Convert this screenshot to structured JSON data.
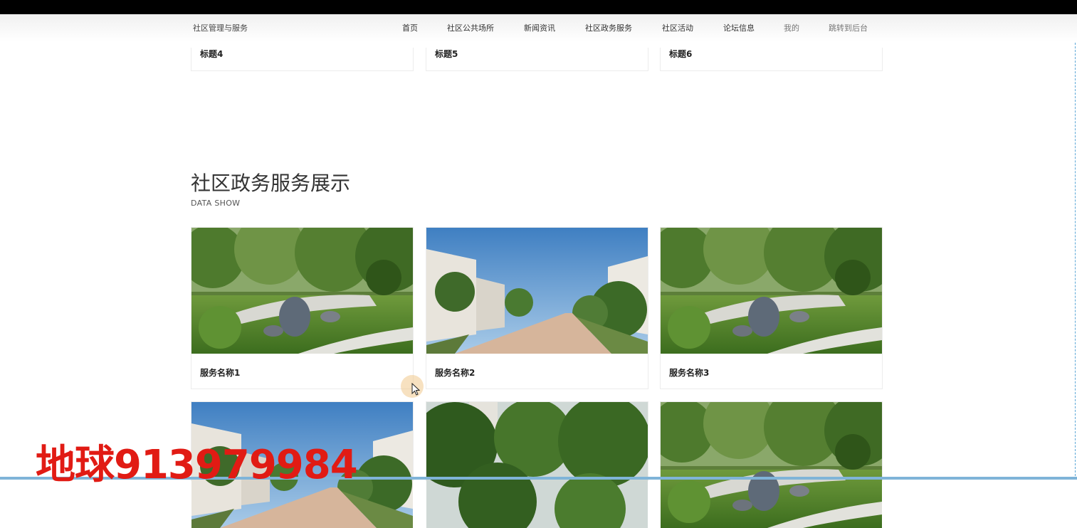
{
  "nav": {
    "brand": "社区管理与服务",
    "items": [
      {
        "label": "首页",
        "muted": false
      },
      {
        "label": "社区公共场所",
        "muted": false
      },
      {
        "label": "新闻资讯",
        "muted": false
      },
      {
        "label": "社区政务服务",
        "muted": false
      },
      {
        "label": "社区活动",
        "muted": false
      },
      {
        "label": "论坛信息",
        "muted": false
      },
      {
        "label": "我的",
        "muted": true
      },
      {
        "label": "跳转到后台",
        "muted": true
      }
    ]
  },
  "prev_section": {
    "titles": [
      "标题4",
      "标题5",
      "标题6"
    ]
  },
  "section": {
    "title": "社区政务服务展示",
    "subtitle": "DATA SHOW",
    "cards": [
      {
        "name": "服务名称1",
        "scene": "garden"
      },
      {
        "name": "服务名称2",
        "scene": "street"
      },
      {
        "name": "服务名称3",
        "scene": "garden"
      },
      {
        "name": "",
        "scene": "street"
      },
      {
        "name": "",
        "scene": "trees"
      },
      {
        "name": "",
        "scene": "garden"
      }
    ]
  },
  "watermark": "地球913979984"
}
